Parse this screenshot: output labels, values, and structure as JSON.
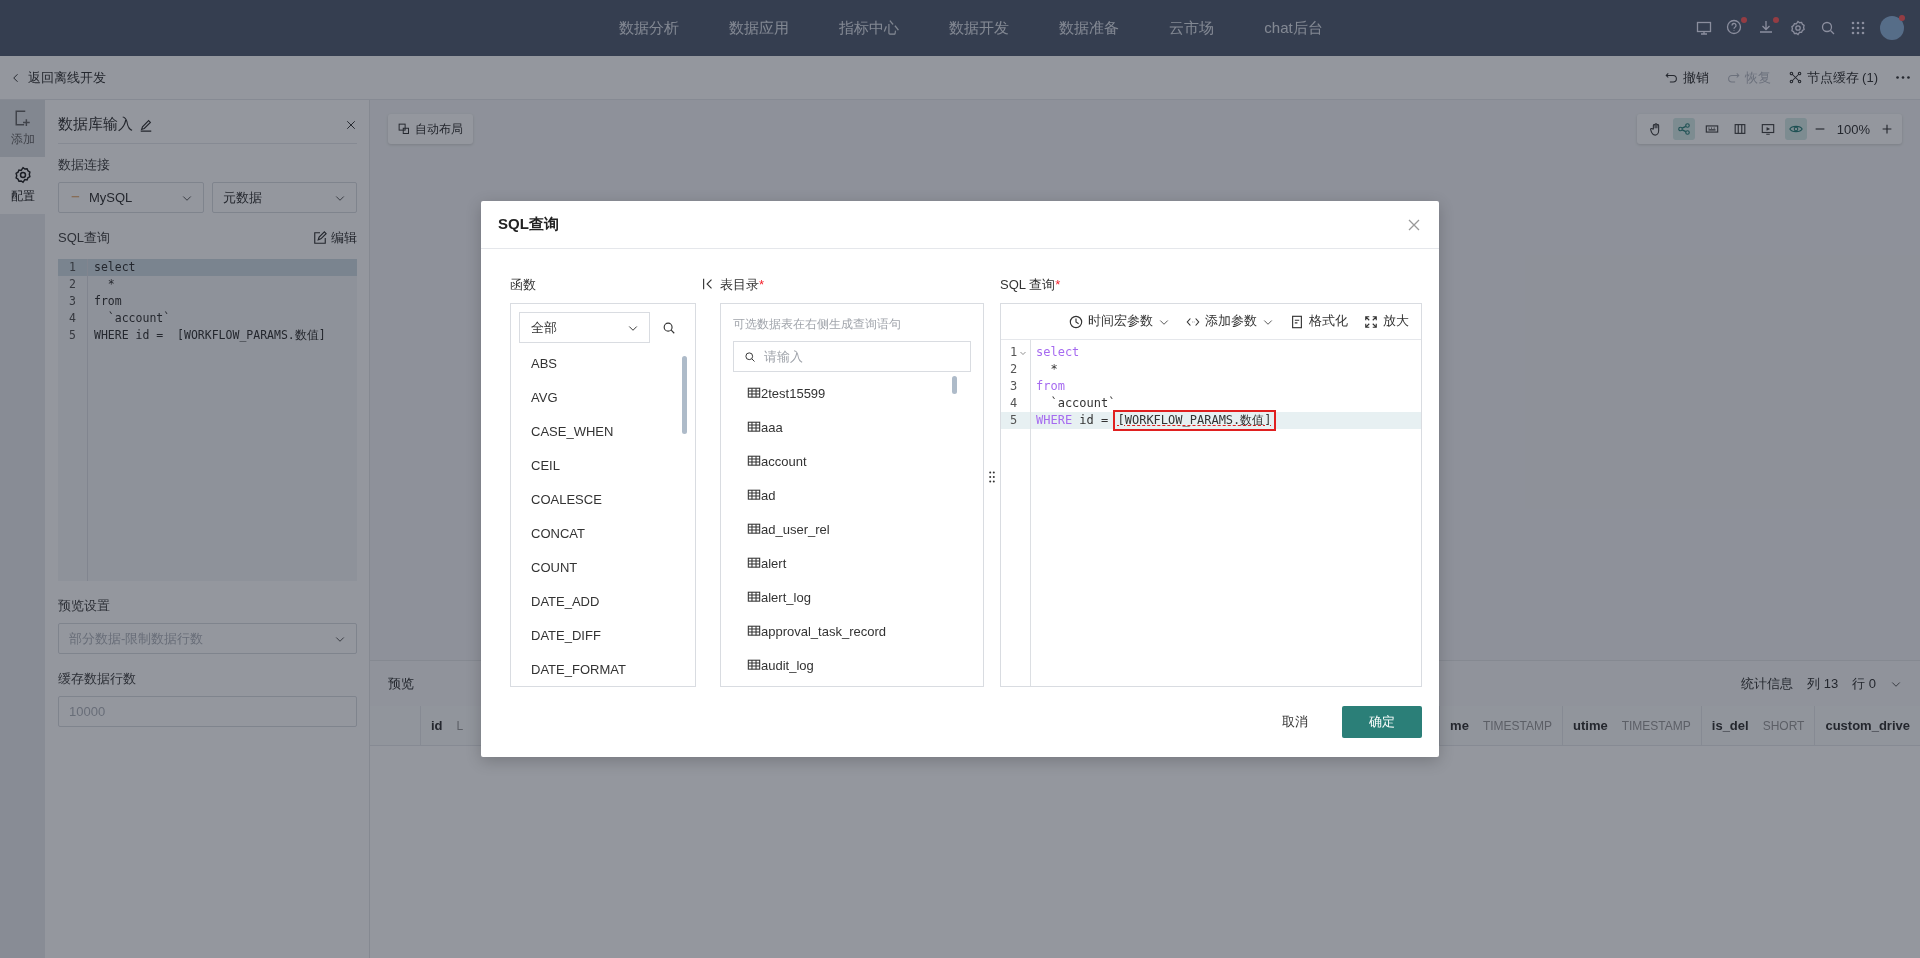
{
  "top_nav": {
    "items": [
      {
        "label": "数据分析"
      },
      {
        "label": "数据应用"
      },
      {
        "label": "指标中心"
      },
      {
        "label": "数据开发"
      },
      {
        "label": "数据准备"
      },
      {
        "label": "云市场"
      },
      {
        "label": "chat后台"
      }
    ]
  },
  "sub_header": {
    "back": "返回离线开发",
    "undo": {
      "label": "撤销",
      "disabled": false
    },
    "redo": {
      "label": "恢复",
      "disabled": true
    },
    "cache": "节点缓存 (1)"
  },
  "rail": [
    {
      "label": "添加",
      "kind": "add",
      "selected": false
    },
    {
      "label": "配置",
      "kind": "settings",
      "selected": true
    }
  ],
  "node_panel": {
    "title": "数据库输入",
    "connection_label": "数据连接",
    "connection_type": "MySQL",
    "database": "元数据",
    "sql_label": "SQL查询",
    "edit": "编辑",
    "sql_lines": [
      {
        "number": "1",
        "text": "select",
        "selected": true
      },
      {
        "number": "2",
        "text": "  *",
        "selected": false
      },
      {
        "number": "3",
        "text": "from",
        "selected": false
      },
      {
        "number": "4",
        "text": "  `account`",
        "selected": false
      },
      {
        "number": "5",
        "text": "WHERE id =  [WORKFLOW_PARAMS.数值]",
        "selected": false
      }
    ],
    "preview_label": "预览设置",
    "preview_placeholder": "部分数据-限制数据行数",
    "cache_label": "缓存数据行数",
    "cache_placeholder": "10000"
  },
  "canvas": {
    "auto_layout": "自动布局",
    "tools": [
      {
        "kind": "hand",
        "selected": false
      },
      {
        "kind": "graph",
        "selected": true
      },
      {
        "kind": "keyboard",
        "selected": false
      },
      {
        "kind": "columns",
        "selected": false
      },
      {
        "kind": "screen",
        "selected": false
      },
      {
        "kind": "eye",
        "selected": true
      }
    ],
    "zoom": "100%"
  },
  "preview": {
    "title": "预览",
    "stats": "统计信息",
    "column_count": "列 13",
    "row_count": "行 0",
    "columns_left": [
      {
        "name": "id",
        "type": "L"
      }
    ],
    "columns_right": [
      {
        "name": "me",
        "type": "TIMESTAMP"
      },
      {
        "name": "utime",
        "type": "TIMESTAMP"
      },
      {
        "name": "is_del",
        "type": "SHORT"
      },
      {
        "name": "custom_drive"
      }
    ]
  },
  "dialog": {
    "title": "SQL查询",
    "functions": {
      "label": "函数",
      "filter": "全部",
      "items": [
        "ABS",
        "AVG",
        "CASE_WHEN",
        "CEIL",
        "COALESCE",
        "CONCAT",
        "COUNT",
        "DATE_ADD",
        "DATE_DIFF",
        "DATE_FORMAT"
      ]
    },
    "catalog": {
      "label": "表目录",
      "required": true,
      "hint": "可选数据表在右侧生成查询语句",
      "search_placeholder": "请输入",
      "tables": [
        "2test15599",
        "aaa",
        "account",
        "ad",
        "ad_user_rel",
        "alert",
        "alert_log",
        "approval_task_record",
        "audit_log"
      ]
    },
    "sql": {
      "label": "SQL 查询",
      "required": true,
      "toolbar": [
        {
          "label": "时间宏参数",
          "kind": "clock",
          "dropdown": true
        },
        {
          "label": "添加参数",
          "kind": "code",
          "dropdown": true
        },
        {
          "label": "格式化",
          "kind": "format",
          "dropdown": false
        },
        {
          "label": "放大",
          "kind": "expand",
          "dropdown": false
        }
      ],
      "lines": [
        {
          "number": "1",
          "foldable": true,
          "selected": false,
          "tokens": [
            {
              "text": "select",
              "kind": "keyword"
            }
          ]
        },
        {
          "number": "2",
          "foldable": false,
          "selected": false,
          "tokens": [
            {
              "text": "  *",
              "kind": "plain"
            }
          ]
        },
        {
          "number": "3",
          "foldable": false,
          "selected": false,
          "tokens": [
            {
              "text": "from",
              "kind": "keyword"
            }
          ]
        },
        {
          "number": "4",
          "foldable": false,
          "selected": false,
          "tokens": [
            {
              "text": "  `account`",
              "kind": "plain"
            }
          ]
        },
        {
          "number": "5",
          "foldable": false,
          "selected": true,
          "tokens": [
            {
              "text": "WHERE",
              "kind": "keyword"
            },
            {
              "text": " id = ",
              "kind": "plain"
            },
            {
              "text": "[WORKFLOW_PARAMS.数值]",
              "kind": "error"
            }
          ]
        }
      ]
    },
    "cancel": "取消",
    "confirm": "确定"
  }
}
